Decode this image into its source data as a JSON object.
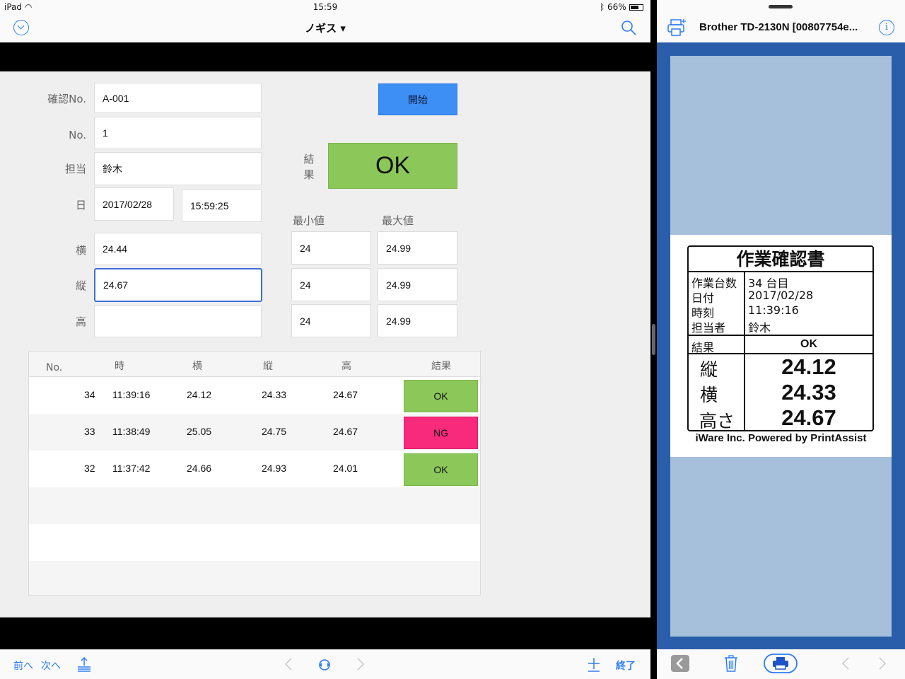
{
  "status_bar": {
    "device": "iPad",
    "time": "15:59",
    "battery": "66%"
  },
  "nav": {
    "title": "ノギス ▾"
  },
  "form": {
    "confirm_no_label": "確認No.",
    "confirm_no_value": "A-001",
    "no_label": "No.",
    "no_value": "1",
    "person_label": "担当",
    "person_value": "鈴木",
    "date_label": "日",
    "date_value": "2017/02/28",
    "time_value": "15:59:25",
    "width_label": "横",
    "width_value": "24.44",
    "length_label": "縦",
    "length_value": "24.67",
    "height_label": "高",
    "height_value": "",
    "start_button": "開始",
    "result_label_1": "結",
    "result_label_2": "果",
    "result_value": "OK",
    "min_label": "最小値",
    "max_label": "最大値",
    "min_values": [
      "24",
      "24",
      "24"
    ],
    "max_values": [
      "24.99",
      "24.99",
      "24.99"
    ]
  },
  "grid": {
    "headers": [
      "No.",
      "時",
      "横",
      "縦",
      "高",
      "結果"
    ],
    "rows": [
      {
        "no": "34",
        "time": "11:39:16",
        "w": "24.12",
        "l": "24.33",
        "h": "24.67",
        "result": "OK"
      },
      {
        "no": "33",
        "time": "11:38:49",
        "w": "25.05",
        "l": "24.75",
        "h": "24.67",
        "result": "NG"
      },
      {
        "no": "32",
        "time": "11:37:42",
        "w": "24.66",
        "l": "24.93",
        "h": "24.01",
        "result": "OK"
      }
    ]
  },
  "colors": {
    "ok": "#8cc75a",
    "ng": "#f72a7b",
    "accent": "#2f7cf6",
    "start": "#3d8ff5"
  },
  "toolbar": {
    "prev": "前へ",
    "next": "次へ",
    "finish": "終了"
  },
  "printer": {
    "title": "Brother TD-2130N [00807754e...",
    "label": {
      "title": "作業確認書",
      "count_key": "作業台数",
      "count_val": "34 台目",
      "date_key": "日付",
      "date_val": "2017/02/28",
      "time_key": "時刻",
      "time_val": "11:39:16",
      "person_key": "担当者",
      "person_val": "鈴木",
      "result_key": "結果",
      "result_val": "OK",
      "length_key": "縦",
      "length_val": "24.12",
      "width_key": "横",
      "width_val": "24.33",
      "height_key": "高さ",
      "height_val": "24.67",
      "footer": "iWare Inc. Powered by PrintAssist"
    }
  }
}
